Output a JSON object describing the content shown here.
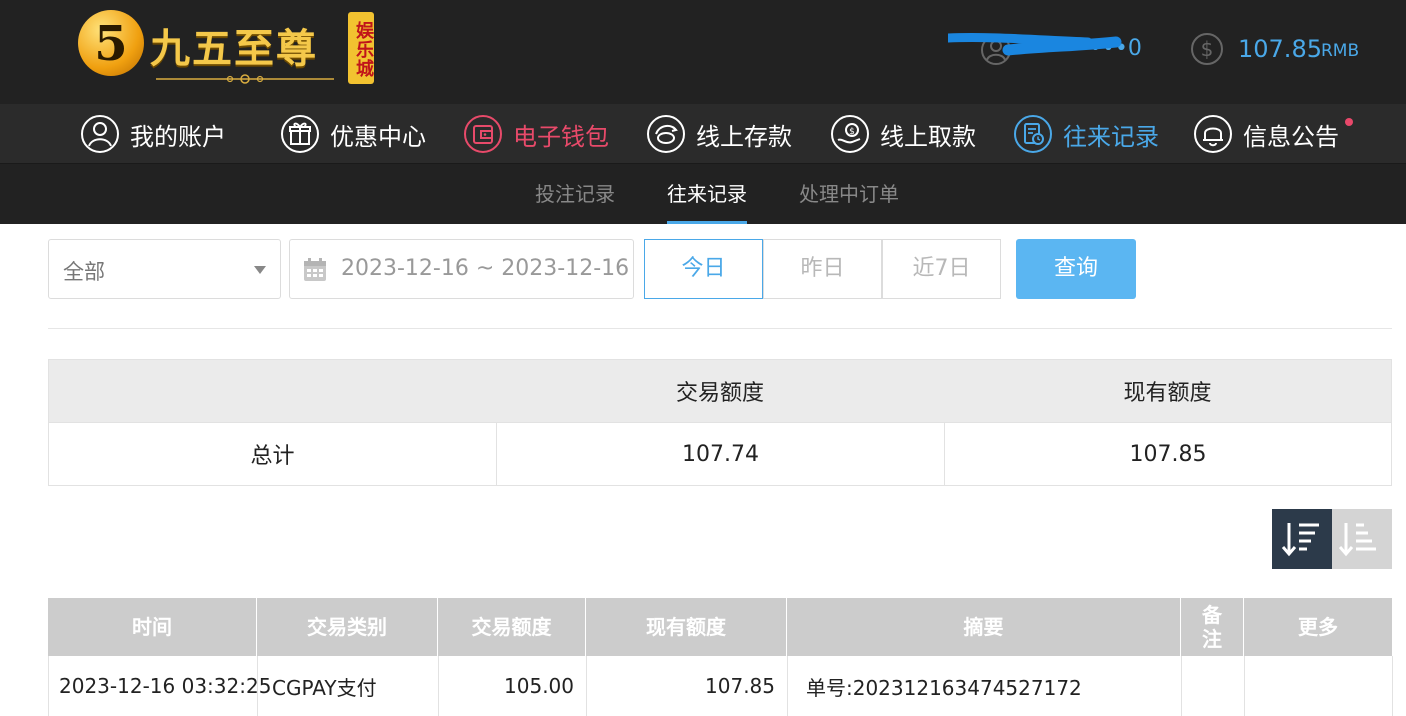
{
  "logo": {
    "numeral": "5",
    "title": "九五至尊",
    "badge": "娱乐城"
  },
  "user": {
    "name": "••••••••0"
  },
  "balance": {
    "amount": "107.85",
    "currency": "RMB"
  },
  "colors": {
    "accent": "#4aa8e8",
    "wallet": "#e84a6a",
    "header_bg": "#222222",
    "nav_bg": "#2b2b2b",
    "notice_dot": "#e8486a"
  },
  "nav": {
    "items": [
      {
        "label": "我的账户",
        "icon": "user-icon"
      },
      {
        "label": "优惠中心",
        "icon": "gift-icon"
      },
      {
        "label": "电子钱包",
        "icon": "wallet-icon"
      },
      {
        "label": "线上存款",
        "icon": "deposit-icon"
      },
      {
        "label": "线上取款",
        "icon": "withdraw-icon"
      },
      {
        "label": "往来记录",
        "icon": "records-icon"
      },
      {
        "label": "信息公告",
        "icon": "bell-icon"
      }
    ]
  },
  "subnav": {
    "tabs": [
      "投注记录",
      "往来记录",
      "处理中订单"
    ],
    "active": "往来记录"
  },
  "filters": {
    "type_selected": "全部",
    "date_range": "2023-12-16 ~ 2023-12-16",
    "quick": [
      "今日",
      "昨日",
      "近7日"
    ],
    "quick_active": "今日",
    "search_label": "查询"
  },
  "summary": {
    "headers": [
      "",
      "交易额度",
      "现有额度"
    ],
    "row": [
      "总计",
      "107.74",
      "107.85"
    ]
  },
  "records": {
    "headers": [
      "时间",
      "交易类别",
      "交易额度",
      "现有额度",
      "摘要",
      "备注",
      "更多"
    ],
    "rows": [
      [
        "2023-12-16 03:32:25",
        "CGPAY支付",
        "105.00",
        "107.85",
        "单号:202312163474527172",
        "",
        ""
      ]
    ]
  }
}
